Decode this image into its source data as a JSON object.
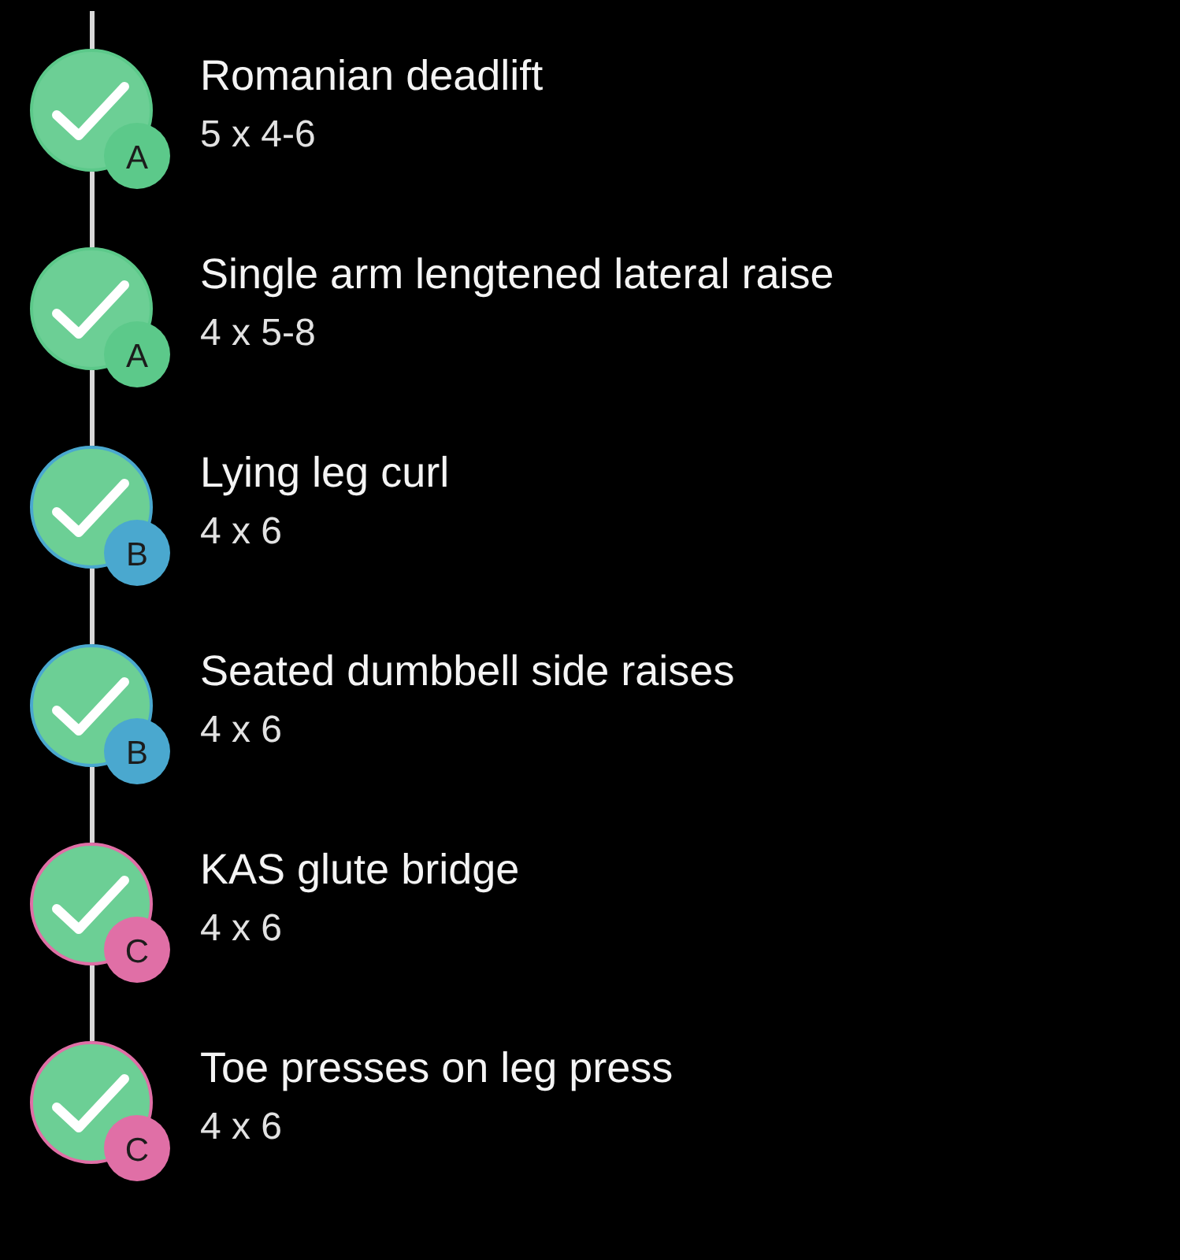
{
  "exercises": [
    {
      "name": "Romanian deadlift",
      "sets": "5 x 4-6",
      "group": "A",
      "color": "#5cc98a",
      "completed": true
    },
    {
      "name": "Single arm lengtened lateral raise",
      "sets": "4 x 5-8",
      "group": "A",
      "color": "#5cc98a",
      "completed": true
    },
    {
      "name": "Lying leg curl",
      "sets": "4 x 6",
      "group": "B",
      "color": "#4aa8cf",
      "completed": true
    },
    {
      "name": "Seated dumbbell side raises",
      "sets": "4 x 6",
      "group": "B",
      "color": "#4aa8cf",
      "completed": true
    },
    {
      "name": "KAS glute bridge",
      "sets": "4 x 6",
      "group": "C",
      "color": "#e06fa6",
      "completed": true
    },
    {
      "name": "Toe presses on leg press",
      "sets": "4 x 6",
      "group": "C",
      "color": "#e06fa6",
      "completed": true
    }
  ]
}
